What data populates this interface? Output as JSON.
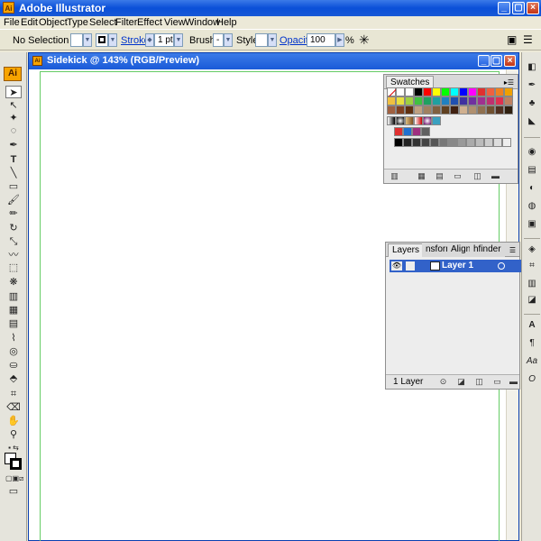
{
  "app": {
    "title": "Adobe Illustrator",
    "icon_text": "Ai",
    "window_buttons": [
      "minimize-icon",
      "maximize-icon",
      "close-icon"
    ]
  },
  "menu": {
    "items": [
      "File",
      "Edit",
      "Object",
      "Type",
      "Select",
      "Filter",
      "Effect",
      "View",
      "Window",
      "Help"
    ]
  },
  "control_bar": {
    "selection_label": "No Selection",
    "stroke_label": "Stroke:",
    "stroke_value": "1 pt",
    "brush_label": "Brush:",
    "brush_value": "-",
    "style_label": "Style:",
    "opacity_label": "Opacity:",
    "opacity_value": "100",
    "opacity_unit": "%"
  },
  "document": {
    "title": "Sidekick @ 143% (RGB/Preview)",
    "icon_text": "Ai"
  },
  "swatches_panel": {
    "tab": "Swatches"
  },
  "layers_panel": {
    "tabs": [
      "Layers",
      "nsform",
      "Align",
      "hfinder"
    ],
    "layer_name": "Layer 1",
    "footer_count": "1 Layer"
  },
  "colors": {
    "titlebar": "#0a4fd8",
    "artboard_border": "#66cc66",
    "layer_selection": "#3262c9"
  }
}
